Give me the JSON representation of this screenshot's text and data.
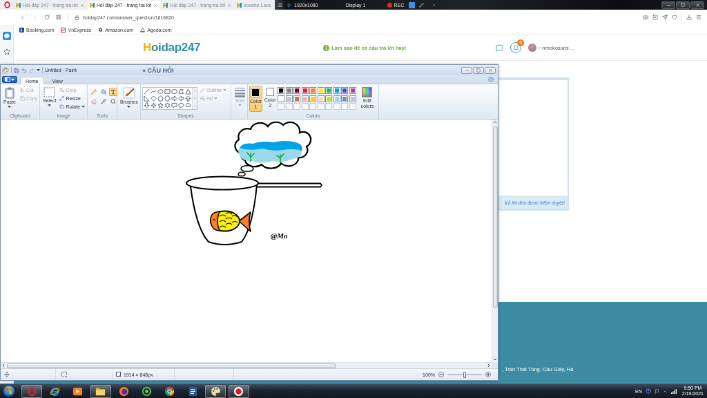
{
  "browser": {
    "tabs": [
      {
        "title": "Hỏi đáp 247 - trang tra lời",
        "selected": false
      },
      {
        "title": "Hỏi đáp 247 - trang tra lời",
        "selected": true
      },
      {
        "title": "Hỏi đáp 247 - trang tra lời",
        "selected": false
      },
      {
        "title": "covene Love",
        "selected": false
      }
    ],
    "recorder": {
      "resolution": "1920x1080",
      "display": "Display 1",
      "status": "REC"
    },
    "url": "hoidap247.com/answer_question/1616820",
    "bookmarks": [
      {
        "label": "Booking.com"
      },
      {
        "label": "VnExpress"
      },
      {
        "label": "Amazon.com"
      },
      {
        "label": "Agoda.com"
      }
    ]
  },
  "website": {
    "logo": "Hoidap247",
    "tip": "Làm sao để có câu trả lời hay!",
    "notification_count": "6",
    "username": "nmokosuris ...",
    "section_heading": "« CÂU HỎI",
    "notice": "trả lời đều được kiểm duyệt!",
    "footer_address": ", Trần Thái Tông, Cầu Giấy, Hà"
  },
  "paint": {
    "title": "Untitled - Paint",
    "tabs": [
      {
        "label": "Home",
        "selected": true
      },
      {
        "label": "View",
        "selected": false
      }
    ],
    "clipboard": {
      "label": "Clipboard",
      "paste": {
        "label": "Paste",
        "disabled": false
      },
      "actions": [
        {
          "label": "Cut",
          "disabled": true
        },
        {
          "label": "Copy",
          "disabled": true
        }
      ]
    },
    "image": {
      "label": "Image",
      "select": {
        "label": "Select",
        "disabled": false
      },
      "actions": [
        {
          "label": "Crop",
          "disabled": true
        },
        {
          "label": "Resize",
          "disabled": false
        },
        {
          "label": "Rotate",
          "disabled": false
        }
      ]
    },
    "tools": {
      "label": "Tools",
      "items": [
        {
          "selected": false
        },
        {
          "selected": false
        },
        {
          "selected": true
        },
        {
          "selected": false
        },
        {
          "selected": false
        },
        {
          "selected": false
        }
      ]
    },
    "brushes": {
      "label": "Brushes"
    },
    "shapes": {
      "label": "Shapes",
      "outline": {
        "label": "Outline",
        "disabled": true
      },
      "fill": {
        "label": "Fill",
        "disabled": true
      }
    },
    "size": {
      "label": "Size",
      "disabled": true
    },
    "colors": {
      "label": "Colors",
      "color1": {
        "label": "Color 1",
        "color": "#000000",
        "selected": true
      },
      "color2": {
        "label": "Color 2",
        "color": "#ffffff",
        "selected": false
      },
      "palette": [
        {
          "color": "#000000"
        },
        {
          "color": "#7f7f7f"
        },
        {
          "color": "#880015"
        },
        {
          "color": "#ed1c24"
        },
        {
          "color": "#ff7f27"
        },
        {
          "color": "#fff200"
        },
        {
          "color": "#22b14c"
        },
        {
          "color": "#00a2e8"
        },
        {
          "color": "#3f48cc"
        },
        {
          "color": "#a349a4"
        },
        {
          "color": "#ffffff"
        },
        {
          "color": "#c3c3c3"
        },
        {
          "color": "#b97a57"
        },
        {
          "color": "#ffaec9"
        },
        {
          "color": "#ffc90e"
        },
        {
          "color": "#efe4b0"
        },
        {
          "color": "#b5e61d"
        },
        {
          "color": "#99d9ea"
        },
        {
          "color": "#7092be"
        },
        {
          "color": "#c8bfe7"
        }
      ],
      "edit": "Edit colors"
    },
    "canvas": {
      "signature": "@Mo"
    },
    "status": {
      "dimensions": "1914 × 848px",
      "zoom": "100%",
      "zoom_slider": {
        "level": 0.5
      }
    }
  },
  "taskbar": {
    "apps": [
      {
        "kind": "opera",
        "running": true
      },
      {
        "kind": "ie",
        "running": false
      },
      {
        "kind": "media",
        "running": false
      },
      {
        "kind": "explorer",
        "running": true
      },
      {
        "kind": "firefox",
        "running": false
      },
      {
        "kind": "coccoc",
        "running": false
      },
      {
        "kind": "chrome",
        "running": false
      },
      {
        "kind": "word",
        "running": false
      },
      {
        "kind": "paint",
        "running": true
      },
      {
        "kind": "recorder",
        "running": true
      }
    ],
    "language": "EN",
    "time": "9:50 PM",
    "date": "2/19/2021"
  }
}
